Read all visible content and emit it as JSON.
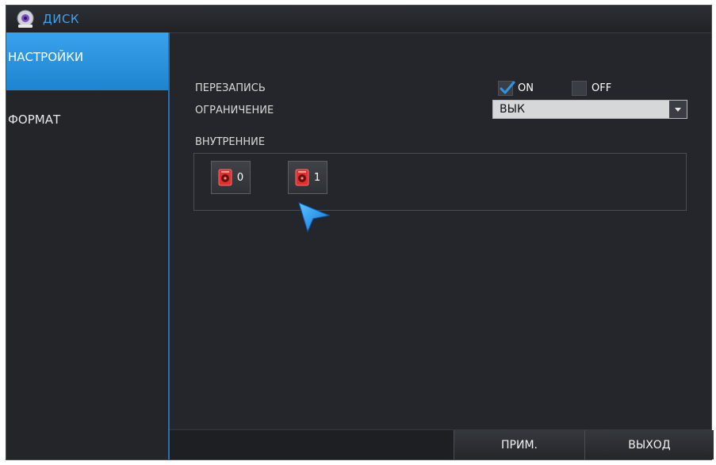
{
  "window": {
    "title": "ДИСК",
    "title_icon": "disc-icon"
  },
  "sidebar": {
    "items": [
      {
        "label": "НАСТРОЙКИ",
        "active": true
      },
      {
        "label": "ФОРМАТ",
        "active": false
      }
    ]
  },
  "settings": {
    "overwrite_label": "ПЕРЕЗАПИСЬ",
    "on_label": "ON",
    "off_label": "OFF",
    "on_checked": true,
    "off_checked": false,
    "limit_label": "ОГРАНИЧЕНИЕ",
    "limit_value": "ВЫК",
    "internal_label": "ВНУТРЕННИЕ"
  },
  "disks": [
    {
      "number": "0",
      "icon": "hdd-icon"
    },
    {
      "number": "1",
      "icon": "hdd-icon"
    }
  ],
  "footer": {
    "apply_label": "ПРИМ.",
    "exit_label": "ВЫХОД"
  },
  "colors": {
    "accent": "#2e95e0",
    "title": "#3fa3ea",
    "disk_icon": "#e03030"
  }
}
